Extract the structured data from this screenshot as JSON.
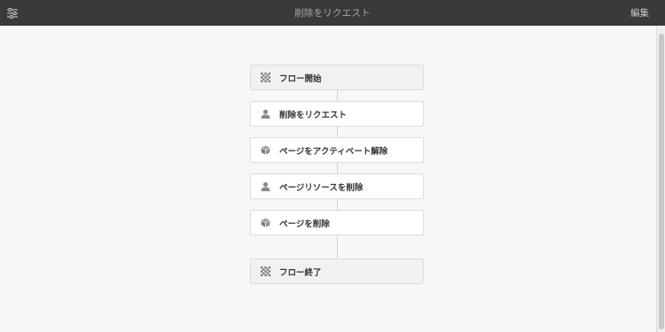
{
  "header": {
    "title": "削除をリクエスト",
    "edit_label": "編集",
    "menu_icon": "sliders-icon"
  },
  "flow": {
    "steps": [
      {
        "label": "フロー開始",
        "type": "start",
        "icon": "checkered-flag-icon"
      },
      {
        "label": "削除をリクエスト",
        "type": "participant",
        "icon": "user-icon"
      },
      {
        "label": "ページをアクティベート解除",
        "type": "process",
        "icon": "cube-icon"
      },
      {
        "label": "ページリソースを削除",
        "type": "participant",
        "icon": "user-icon"
      },
      {
        "label": "ページを削除",
        "type": "process",
        "icon": "cube-icon"
      },
      {
        "label": "フロー終了",
        "type": "end",
        "icon": "checkered-flag-icon"
      }
    ]
  }
}
